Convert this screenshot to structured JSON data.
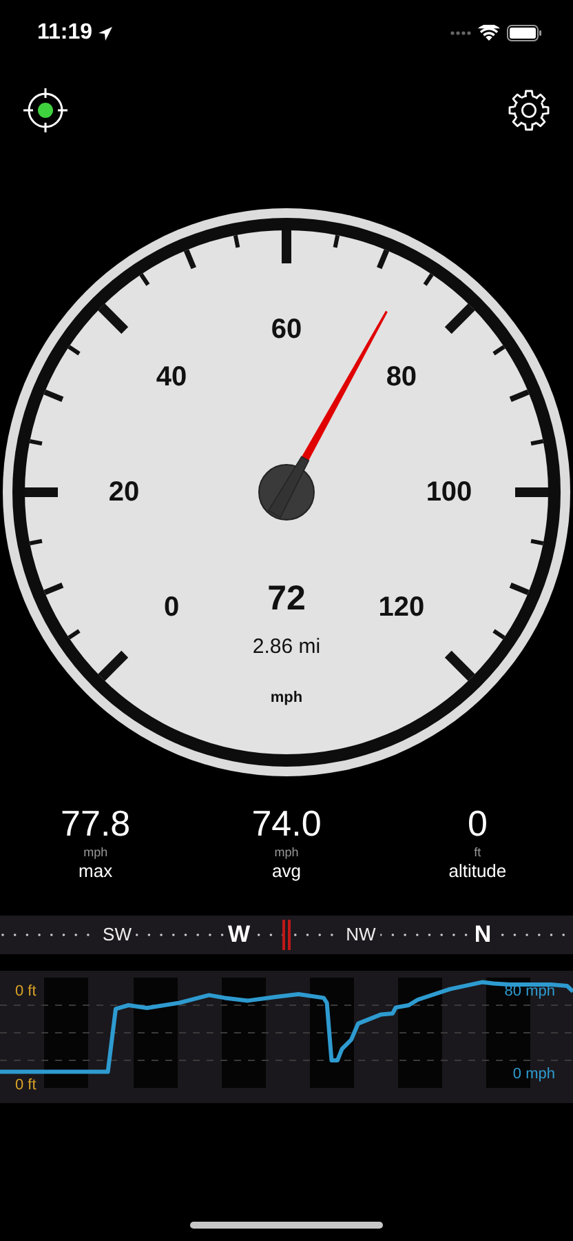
{
  "status_bar": {
    "time": "11:19"
  },
  "toolbar": {
    "gps_fix": true
  },
  "gauge": {
    "labels": [
      "0",
      "20",
      "40",
      "60",
      "80",
      "100",
      "120"
    ],
    "speed": "72",
    "distance": "2.86 mi",
    "unit": "mph"
  },
  "stats": [
    {
      "value": "77.8",
      "unit": "mph",
      "label": "max"
    },
    {
      "value": "74.0",
      "unit": "mph",
      "label": "avg"
    },
    {
      "value": "0",
      "unit": "ft",
      "label": "altitude"
    }
  ],
  "compass": {
    "labels": [
      "SW",
      "W",
      "NW",
      "N"
    ]
  },
  "chart": {
    "left_labels": [
      "0 ft",
      "0 ft"
    ],
    "right_labels": [
      "80 mph",
      "0 mph"
    ]
  }
}
